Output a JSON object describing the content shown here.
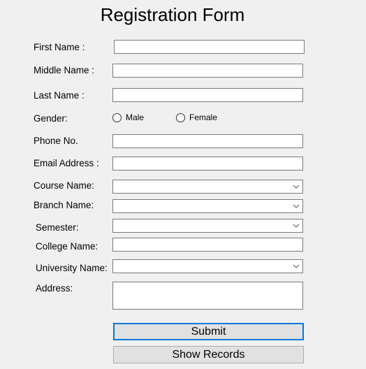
{
  "form": {
    "title": "Registration Form",
    "fields": {
      "first_name": {
        "label": "First Name :",
        "value": ""
      },
      "middle_name": {
        "label": "Middle Name :",
        "value": ""
      },
      "last_name": {
        "label": "Last Name :",
        "value": ""
      },
      "gender": {
        "label": "Gender:",
        "options": [
          "Male",
          "Female"
        ],
        "selected": null
      },
      "phone": {
        "label": "Phone No.",
        "value": ""
      },
      "email": {
        "label": "Email Address :",
        "value": ""
      },
      "course": {
        "label": "Course Name:",
        "selected": ""
      },
      "branch": {
        "label": "Branch Name:",
        "selected": ""
      },
      "semester": {
        "label": "Semester:",
        "selected": ""
      },
      "college": {
        "label": "College Name:",
        "value": ""
      },
      "university": {
        "label": "University Name:",
        "selected": ""
      },
      "address": {
        "label": "Address:",
        "value": ""
      }
    },
    "buttons": {
      "submit": "Submit",
      "show_records": "Show Records"
    }
  },
  "colors": {
    "background": "#f0f0f0",
    "focus_border": "#0078d7",
    "button_face": "#e1e1e1"
  }
}
